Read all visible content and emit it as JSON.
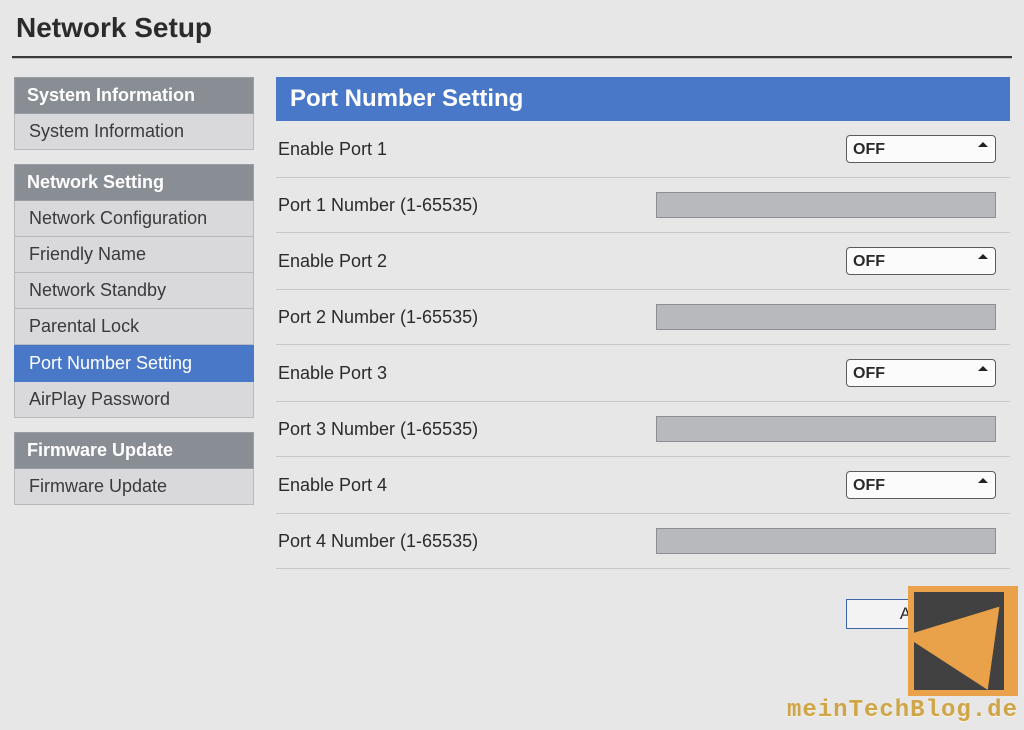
{
  "page_title": "Network Setup",
  "sidebar": {
    "groups": [
      {
        "header": "System Information",
        "items": [
          {
            "label": "System Information",
            "active": false
          }
        ]
      },
      {
        "header": "Network Setting",
        "items": [
          {
            "label": "Network Configuration",
            "active": false
          },
          {
            "label": "Friendly Name",
            "active": false
          },
          {
            "label": "Network Standby",
            "active": false
          },
          {
            "label": "Parental Lock",
            "active": false
          },
          {
            "label": "Port Number Setting",
            "active": true
          },
          {
            "label": "AirPlay Password",
            "active": false
          }
        ]
      },
      {
        "header": "Firmware Update",
        "items": [
          {
            "label": "Firmware Update",
            "active": false
          }
        ]
      }
    ]
  },
  "panel": {
    "title": "Port Number Setting",
    "rows": [
      {
        "kind": "select",
        "label": "Enable Port 1",
        "value": "OFF"
      },
      {
        "kind": "input",
        "label": "Port 1 Number (1-65535)",
        "value": ""
      },
      {
        "kind": "select",
        "label": "Enable Port 2",
        "value": "OFF"
      },
      {
        "kind": "input",
        "label": "Port 2 Number (1-65535)",
        "value": ""
      },
      {
        "kind": "select",
        "label": "Enable Port 3",
        "value": "OFF"
      },
      {
        "kind": "input",
        "label": "Port 3 Number (1-65535)",
        "value": ""
      },
      {
        "kind": "select",
        "label": "Enable Port 4",
        "value": "OFF"
      },
      {
        "kind": "input",
        "label": "Port 4 Number (1-65535)",
        "value": ""
      }
    ],
    "apply_label": "Apply"
  },
  "watermark": {
    "text": "meinTechBlog.de"
  }
}
